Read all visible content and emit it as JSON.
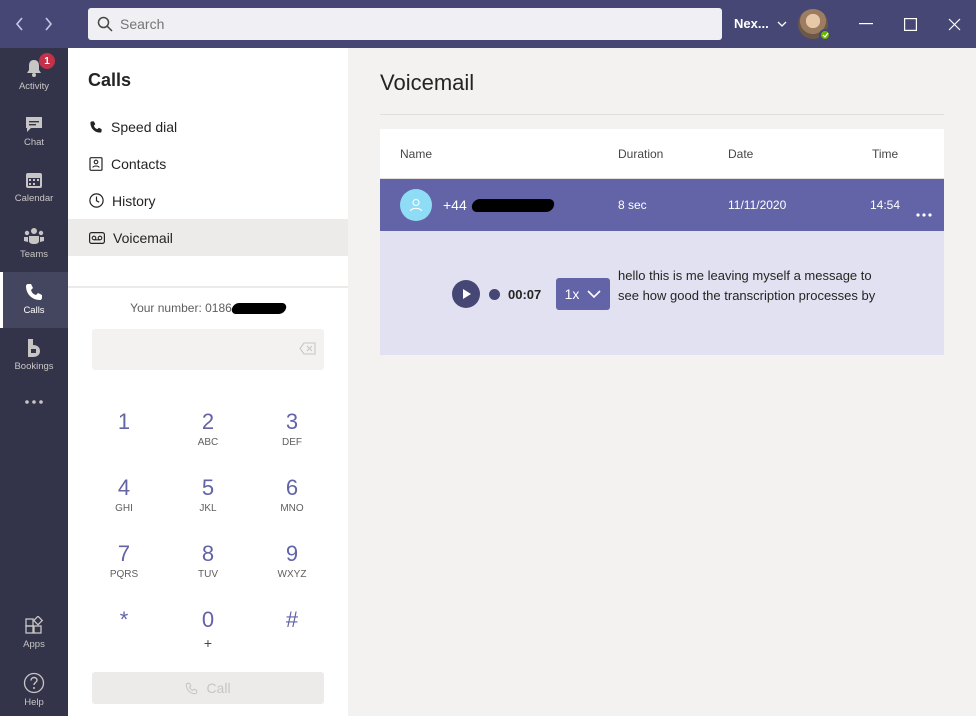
{
  "titlebar": {
    "back_icon": "chevron-left-icon",
    "forward_icon": "chevron-right-icon",
    "search_placeholder": "Search",
    "org_label": "Nex...",
    "window_controls": [
      "minimize-icon",
      "maximize-icon",
      "close-icon"
    ]
  },
  "rail": {
    "items": [
      {
        "label": "Activity",
        "icon": "bell-icon",
        "badge": "1"
      },
      {
        "label": "Chat",
        "icon": "chat-icon"
      },
      {
        "label": "Calendar",
        "icon": "calendar-icon"
      },
      {
        "label": "Teams",
        "icon": "teams-icon"
      },
      {
        "label": "Calls",
        "icon": "phone-icon",
        "active": true
      },
      {
        "label": "Bookings",
        "icon": "bookings-icon"
      }
    ],
    "more": "...",
    "bottom": [
      {
        "label": "Apps",
        "icon": "apps-icon"
      },
      {
        "label": "Help",
        "icon": "help-icon"
      }
    ]
  },
  "calls": {
    "title": "Calls",
    "items": [
      {
        "label": "Speed dial",
        "icon": "phone-icon"
      },
      {
        "label": "Contacts",
        "icon": "contacts-icon"
      },
      {
        "label": "History",
        "icon": "clock-icon"
      },
      {
        "label": "Voicemail",
        "icon": "voicemail-icon",
        "selected": true
      }
    ],
    "your_number_label": "Your number: 0186",
    "keypad": [
      {
        "digit": "1",
        "letters": ""
      },
      {
        "digit": "2",
        "letters": "ABC"
      },
      {
        "digit": "3",
        "letters": "DEF"
      },
      {
        "digit": "4",
        "letters": "GHI"
      },
      {
        "digit": "5",
        "letters": "JKL"
      },
      {
        "digit": "6",
        "letters": "MNO"
      },
      {
        "digit": "7",
        "letters": "PQRS"
      },
      {
        "digit": "8",
        "letters": "TUV"
      },
      {
        "digit": "9",
        "letters": "WXYZ"
      },
      {
        "digit": "*",
        "letters": ""
      },
      {
        "digit": "0",
        "letters": "+"
      },
      {
        "digit": "#",
        "letters": ""
      }
    ],
    "call_label": "Call"
  },
  "voicemail": {
    "title": "Voicemail",
    "columns": [
      "Name",
      "Duration",
      "Date",
      "Time"
    ],
    "row": {
      "number_prefix": "+44",
      "duration": "8 sec",
      "date": "11/11/2020",
      "time": "14:54"
    },
    "player": {
      "elapsed": "00:07",
      "speed": "1x"
    },
    "transcript": "hello this is me leaving myself a message to see how good the transcription processes by"
  },
  "colors": {
    "titlebar": "#464775",
    "rail": "#33344a",
    "accent": "#6264a7",
    "expanded_bg": "#e1e1f1"
  }
}
